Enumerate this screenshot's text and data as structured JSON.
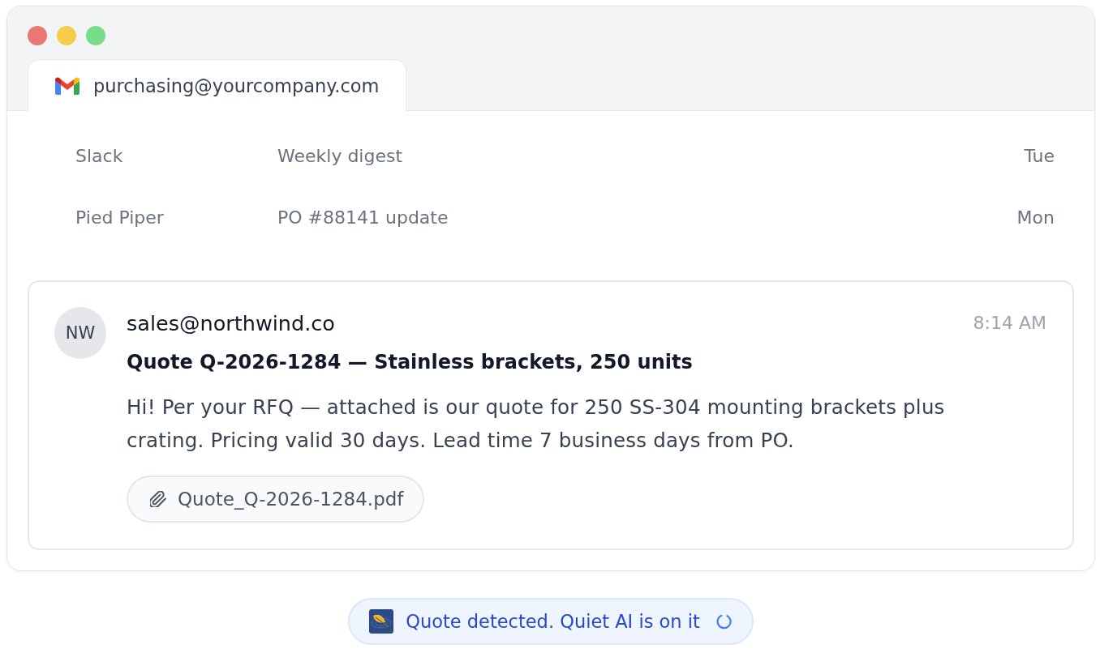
{
  "tabs": [
    {
      "label": "purchasing@yourcompany.com",
      "selected": true
    }
  ],
  "inbox": [
    {
      "sender": "Slack",
      "subject": "Weekly digest",
      "date": "Tue"
    },
    {
      "sender": "Pied Piper",
      "subject": "PO #88141 update",
      "date": "Mon"
    }
  ],
  "open_email": {
    "avatar": "NW",
    "sender": "sales@northwind.co",
    "time": "8:14 AM",
    "subject": "Quote Q-2026-1284 — Stainless brackets, 250 units",
    "body": "Hi! Per your RFQ — attached is our quote for 250 SS-304 mounting brackets plus crating. Pricing valid 30 days. Lead time 7 business days from PO.",
    "attachments": [
      "Quote_Q-2026-1284.pdf"
    ]
  },
  "status_banner": {
    "text": "Quote detected. Quiet AI is on it"
  }
}
